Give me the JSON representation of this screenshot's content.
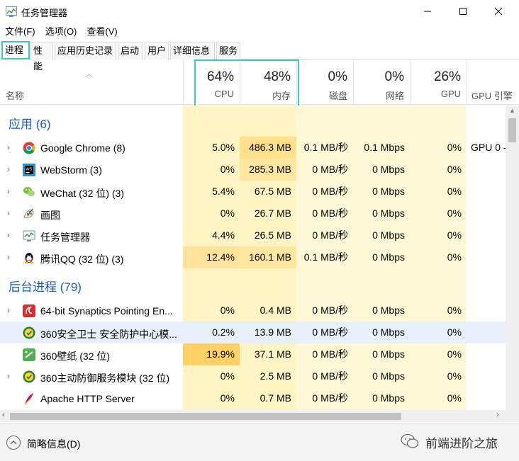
{
  "window": {
    "title": "任务管理器"
  },
  "menu": [
    "文件(F)",
    "选项(O)",
    "查看(V)"
  ],
  "tabs": [
    "进程",
    "性能",
    "应用历史记录",
    "启动",
    "用户",
    "详细信息",
    "服务"
  ],
  "header": {
    "name_label": "名称",
    "columns": [
      {
        "key": "cpu",
        "pct": "64%",
        "label": "CPU"
      },
      {
        "key": "mem",
        "pct": "48%",
        "label": "内存"
      },
      {
        "key": "disk",
        "pct": "0%",
        "label": "磁盘"
      },
      {
        "key": "net",
        "pct": "0%",
        "label": "网络"
      },
      {
        "key": "gpu",
        "pct": "26%",
        "label": "GPU"
      },
      {
        "key": "gpue",
        "pct": "",
        "label": "GPU 引擎"
      }
    ]
  },
  "groups": [
    {
      "label": "应用 (6)",
      "rows": [
        {
          "name": "Google Chrome (8)",
          "icon": "chrome-icon",
          "expandable": true,
          "cpu": "5.0%",
          "mem": "486.3 MB",
          "disk": "0.1 MB/秒",
          "net": "0.1 Mbps",
          "gpu": "0%",
          "gpue": "GPU 0 -"
        },
        {
          "name": "WebStorm (3)",
          "icon": "webstorm-icon",
          "expandable": true,
          "cpu": "0%",
          "mem": "285.3 MB",
          "disk": "0 MB/秒",
          "net": "0 Mbps",
          "gpu": "0%",
          "gpue": ""
        },
        {
          "name": "WeChat (32 位) (3)",
          "icon": "wechat-icon",
          "expandable": true,
          "cpu": "5.4%",
          "mem": "67.5 MB",
          "disk": "0 MB/秒",
          "net": "0 Mbps",
          "gpu": "0%",
          "gpue": ""
        },
        {
          "name": "画图",
          "icon": "paint-icon",
          "expandable": true,
          "cpu": "0%",
          "mem": "26.7 MB",
          "disk": "0 MB/秒",
          "net": "0 Mbps",
          "gpu": "0%",
          "gpue": ""
        },
        {
          "name": "任务管理器",
          "icon": "task-manager-icon",
          "expandable": true,
          "cpu": "4.4%",
          "mem": "26.5 MB",
          "disk": "0 MB/秒",
          "net": "0 Mbps",
          "gpu": "0%",
          "gpue": ""
        },
        {
          "name": "腾讯QQ (32 位) (3)",
          "icon": "qq-icon",
          "expandable": true,
          "cpu": "12.4%",
          "mem": "160.1 MB",
          "disk": "0.1 MB/秒",
          "net": "0 Mbps",
          "gpu": "0%",
          "gpue": ""
        }
      ]
    },
    {
      "label": "后台进程 (79)",
      "rows": [
        {
          "name": "64-bit Synaptics Pointing En...",
          "icon": "synaptics-icon",
          "expandable": true,
          "cpu": "0%",
          "mem": "0.4 MB",
          "disk": "0 MB/秒",
          "net": "0 Mbps",
          "gpu": "0%",
          "gpue": ""
        },
        {
          "name": "360安全卫士 安全防护中心模...",
          "icon": "360-safe-icon",
          "expandable": false,
          "selected": true,
          "cpu": "0.2%",
          "mem": "13.9 MB",
          "disk": "0 MB/秒",
          "net": "0 Mbps",
          "gpu": "0%",
          "gpue": ""
        },
        {
          "name": "360壁纸 (32 位)",
          "icon": "360-wallpaper-icon",
          "expandable": false,
          "cpu": "19.9%",
          "mem": "37.1 MB",
          "disk": "0 MB/秒",
          "net": "0 Mbps",
          "gpu": "0%",
          "gpue": ""
        },
        {
          "name": "360主动防御服务模块 (32 位)",
          "icon": "360-defense-icon",
          "expandable": true,
          "cpu": "0%",
          "mem": "2.5 MB",
          "disk": "0 MB/秒",
          "net": "0 Mbps",
          "gpu": "0%",
          "gpue": ""
        },
        {
          "name": "Apache HTTP Server",
          "icon": "apache-icon",
          "expandable": false,
          "cpu": "0%",
          "mem": "0.7 MB",
          "disk": "0 MB/秒",
          "net": "0 Mbps",
          "gpu": "0%",
          "gpue": ""
        }
      ]
    }
  ],
  "footer": {
    "fewer_details": "简略信息(D)",
    "watermark": "前端进阶之旅"
  },
  "colors": {
    "accent": "#3cc7c7",
    "group_text": "#1a5fb4",
    "heat_light": "#fff4c4",
    "heat_mid": "#ffe7a0",
    "heat_high": "#ffd166",
    "selected_row": "#e7f0fb"
  }
}
